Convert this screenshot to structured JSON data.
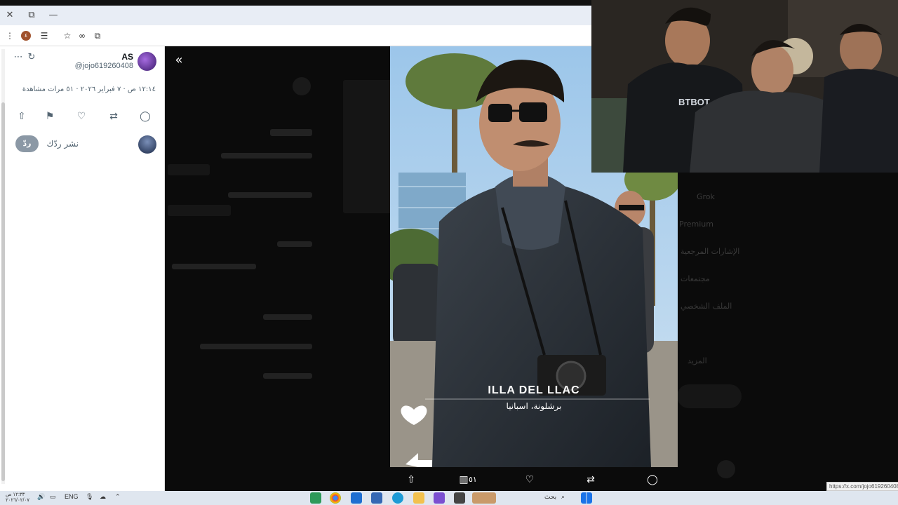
{
  "browser": {
    "window_controls": {
      "close": "✕",
      "restore": "⧉",
      "minimize": "—"
    }
  },
  "post": {
    "author_name": "AS",
    "author_handle": "@jojo619260408",
    "meta": "١٢:١٤ ص · ٧ فبراير ٢٠٢٦ · ٥١ مرات مشاهدة",
    "reply_placeholder": "نشر ردّك",
    "reply_button": "ردّ"
  },
  "media": {
    "caption_title": "ILLA DEL LLAC",
    "caption_subtitle": "برشلونة، اسبانيا",
    "views_count": "٥١"
  },
  "background_menu": [
    "Grok",
    "Premium",
    "الإشارات المرجعية",
    "مجتمعات",
    "الملف الشخصي",
    "المزيد"
  ],
  "webcam": {
    "shirt_text": "BTBOT"
  },
  "taskbar": {
    "language": "ENG",
    "search_label": "بحث",
    "clock_time": "١٢:٣٣ ص",
    "clock_date": "٢٠٢٦/٠٢/٠٧"
  },
  "status_url": "https://x.com/jojo619260408",
  "colors": {
    "accent": "#1d9bf0",
    "text_secondary": "#536471",
    "background_dim": "#0b0b0b"
  }
}
